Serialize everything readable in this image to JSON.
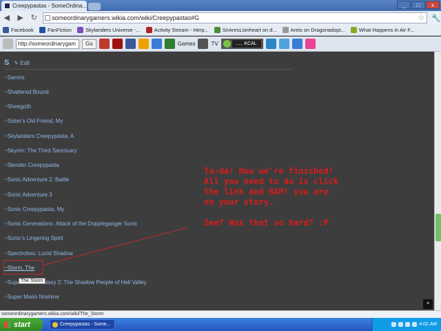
{
  "browser": {
    "tab_title": "Creepypastas - SomeOrdina...",
    "tab_close": "x",
    "url": "someordinarygamers.wikia.com/wiki/Creepypastas#G",
    "back": "◀",
    "forward": "▶",
    "reload": "↻",
    "star": "☆",
    "wrench": "🔧",
    "window_buttons": [
      "_",
      "□",
      "x"
    ]
  },
  "bookmarks": [
    {
      "label": "Facebook",
      "color": "#3b5998"
    },
    {
      "label": "FanFiction",
      "color": "#1f4fa0"
    },
    {
      "label": "Skylanders Universe -...",
      "color": "#7a4fb5"
    },
    {
      "label": "Activity Stream - Herp...",
      "color": "#b22222"
    },
    {
      "label": "SirAresLionheart on d...",
      "color": "#4a8a3a"
    },
    {
      "label": "Areis on Dragonadopt...",
      "color": "#999999"
    },
    {
      "label": "What Happens in Air F...",
      "color": "#88aa22"
    }
  ],
  "addon_bar": {
    "search_value": "http://someordinarygam",
    "go_label": "Go",
    "games_label": "Games",
    "tv_label": "TV",
    "station": "..... KCAL"
  },
  "page": {
    "section_letter": "S",
    "edit_label": "Edit",
    "stories": [
      "~Samris",
      "~Shattered Bound",
      "~Sheegoth",
      "~Sister's Old Friend, My",
      "~Skylanders Creepypasta, A",
      "~Skyrim: The Third Sanctuary",
      "~Slender Creepypasta",
      "~Sonic Adventure 2: Battle",
      "~Sonic Adventure 3",
      "~Sonic Creepypasta, My",
      "~Sonic Generations: Attack of the Doppleganger Sonic",
      "~Sonic's Lingering Spirit",
      "~Spectrobes: Lucid Shadow",
      "~Storm, The",
      "~Super Mario Galaxy 2: The Shadow People of Hell Valley",
      "~Super Mario Noshine"
    ],
    "tooltip": "The Storm",
    "annotation_line1": "Ta-da! Now we're finished! All you need to do is click the link and BAM! you are on your story.",
    "annotation_line2": "See? Was that so hard? :P",
    "scroll_top": "^"
  },
  "status_url": "someordinarygamers.wikia.com/wiki/The_Storm",
  "taskbar": {
    "start_label": "start",
    "task_label": "Creepypastas - Some...",
    "clock": "4:02 AM"
  }
}
